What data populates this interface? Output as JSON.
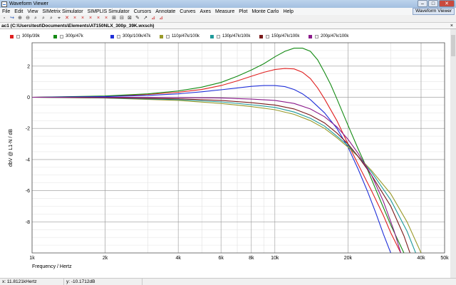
{
  "window": {
    "title": "Waveform Viewer",
    "controls": {
      "minimize": "–",
      "maximize": "□",
      "close": "✕"
    }
  },
  "menu": {
    "items": [
      "File",
      "Edit",
      "View",
      "SIMetrix Simulator",
      "SIMPLIS Simulator",
      "Cursors",
      "Annotate",
      "Curves",
      "Axes",
      "Measure",
      "Plot",
      "Monte Carlo",
      "Help"
    ],
    "right_tag": "Waveform Viewer"
  },
  "toolbar": {
    "icons": [
      "new-icon",
      "open-icon",
      "zoom-in-icon",
      "zoom-out-icon",
      "zoom-fit-icon",
      "zoom-x-icon",
      "zoom-y-icon",
      "cursor-icon",
      "delete-icon",
      "cross-icon",
      "cross-icon",
      "cross-icon",
      "cross-icon",
      "cross-icon",
      "measure-icon",
      "measure-icon",
      "measure-icon",
      "annotate-icon",
      "annotate-icon",
      "probe-icon",
      "probe-icon"
    ]
  },
  "tab": {
    "label": "ac1 (C:\\Users\\test\\Documents\\Elements\\AT150NLX_300p_39K.wxsch)",
    "close": "×"
  },
  "legend": [
    {
      "label": "300p/39k",
      "color": "#e02020"
    },
    {
      "label": "300p/47k",
      "color": "#138a13"
    },
    {
      "label": "300p/100k/47k",
      "color": "#1f2fd8"
    },
    {
      "label": "110p/47k/100k",
      "color": "#9a9a2a"
    },
    {
      "label": "130p/47k/100k",
      "color": "#1f9a9a"
    },
    {
      "label": "150p/47k/100k",
      "color": "#7a1a1a"
    },
    {
      "label": "200p/47k/100k",
      "color": "#8a1a8a"
    }
  ],
  "chart_data": {
    "type": "line",
    "xlabel": "Frequency / Hertz",
    "ylabel": "dbV @ L1-N / dB",
    "x_scale": "log",
    "xlim": [
      1000,
      50000
    ],
    "ylim": [
      -10,
      3.5
    ],
    "grid": true,
    "x_ticks": [
      {
        "value": 1000,
        "label": "1k"
      },
      {
        "value": 2000,
        "label": "2k"
      },
      {
        "value": 4000,
        "label": "4k"
      },
      {
        "value": 6000,
        "label": "6k"
      },
      {
        "value": 8000,
        "label": "8k"
      },
      {
        "value": 10000,
        "label": "10k"
      },
      {
        "value": 20000,
        "label": "20k"
      },
      {
        "value": 40000,
        "label": "40k"
      },
      {
        "value": 50000,
        "label": "50k"
      }
    ],
    "y_ticks": [
      2,
      0,
      -2,
      -4,
      -6,
      -8
    ],
    "series": [
      {
        "name": "300p/39k",
        "color": "#e02020",
        "x": [
          1000,
          2000,
          3000,
          4000,
          5000,
          6000,
          7000,
          8000,
          9000,
          10000,
          11000,
          12000,
          13000,
          14000,
          15000,
          16000,
          18000,
          20000,
          22000,
          25000,
          28000,
          30000,
          33000
        ],
        "y": [
          0,
          0.05,
          0.18,
          0.32,
          0.5,
          0.75,
          1.05,
          1.35,
          1.6,
          1.78,
          1.85,
          1.82,
          1.6,
          1.2,
          0.6,
          -0.1,
          -1.5,
          -3.0,
          -4.3,
          -6.0,
          -7.6,
          -8.7,
          -10
        ]
      },
      {
        "name": "300p/47k",
        "color": "#138a13",
        "x": [
          1000,
          2000,
          3000,
          4000,
          5000,
          6000,
          7000,
          8000,
          9000,
          10000,
          11000,
          12000,
          13000,
          14000,
          15000,
          16000,
          17000,
          18000,
          20000,
          22000,
          24000,
          26000,
          28000,
          30000,
          34000
        ],
        "y": [
          0,
          0.08,
          0.22,
          0.4,
          0.65,
          0.95,
          1.35,
          1.75,
          2.15,
          2.6,
          2.95,
          3.15,
          3.15,
          2.95,
          2.4,
          1.6,
          0.8,
          -0.1,
          -1.8,
          -3.3,
          -4.6,
          -5.9,
          -7.1,
          -8.2,
          -10
        ]
      },
      {
        "name": "300p/100k/47k",
        "color": "#1f2fd8",
        "x": [
          1000,
          2000,
          3000,
          4000,
          5000,
          6000,
          7000,
          8000,
          9000,
          10000,
          11000,
          12000,
          13000,
          14000,
          16000,
          18000,
          20000,
          22000,
          24000,
          26000,
          28000,
          30000
        ],
        "y": [
          0,
          0.04,
          0.12,
          0.22,
          0.35,
          0.48,
          0.6,
          0.7,
          0.75,
          0.75,
          0.68,
          0.5,
          0.22,
          -0.15,
          -1.0,
          -2.0,
          -3.2,
          -4.6,
          -6.0,
          -7.4,
          -8.8,
          -10
        ]
      },
      {
        "name": "110p/47k/100k",
        "color": "#9a9a2a",
        "x": [
          1000,
          2000,
          4000,
          6000,
          8000,
          10000,
          12000,
          14000,
          16000,
          18000,
          20000,
          22000,
          25000,
          30000,
          35000,
          40000
        ],
        "y": [
          0,
          -0.05,
          -0.2,
          -0.4,
          -0.6,
          -0.8,
          -1.1,
          -1.5,
          -2.0,
          -2.6,
          -3.2,
          -3.8,
          -4.7,
          -6.2,
          -8.0,
          -10
        ]
      },
      {
        "name": "130p/47k/100k",
        "color": "#1f9a9a",
        "x": [
          1000,
          2000,
          4000,
          6000,
          8000,
          10000,
          12000,
          14000,
          16000,
          18000,
          20000,
          22000,
          25000,
          30000,
          35000,
          38000
        ],
        "y": [
          0,
          -0.04,
          -0.15,
          -0.3,
          -0.48,
          -0.65,
          -0.95,
          -1.35,
          -1.85,
          -2.5,
          -3.1,
          -3.8,
          -4.8,
          -6.6,
          -8.6,
          -10
        ]
      },
      {
        "name": "150p/47k/100k",
        "color": "#7a1a1a",
        "x": [
          1000,
          2000,
          4000,
          6000,
          8000,
          10000,
          12000,
          14000,
          16000,
          18000,
          20000,
          22000,
          25000,
          30000,
          34000,
          36000
        ],
        "y": [
          0,
          -0.03,
          -0.1,
          -0.2,
          -0.35,
          -0.5,
          -0.75,
          -1.15,
          -1.65,
          -2.3,
          -3.0,
          -3.8,
          -5.0,
          -7.0,
          -8.9,
          -10
        ]
      },
      {
        "name": "200p/47k/100k",
        "color": "#8a1a8a",
        "x": [
          1000,
          2000,
          4000,
          6000,
          8000,
          10000,
          12000,
          14000,
          16000,
          18000,
          20000,
          22000,
          25000,
          28000,
          31000,
          33000
        ],
        "y": [
          0,
          0.0,
          -0.02,
          -0.05,
          -0.12,
          -0.2,
          -0.4,
          -0.75,
          -1.25,
          -1.9,
          -2.7,
          -3.6,
          -5.0,
          -6.7,
          -8.6,
          -10
        ]
      }
    ]
  },
  "status": {
    "x_readout": "x: 11.8121kHertz",
    "y_readout": "y: -10.1712dB"
  }
}
